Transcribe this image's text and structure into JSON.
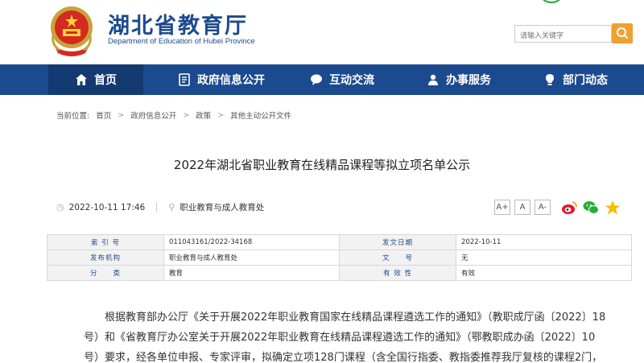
{
  "header": {
    "title": "湖北省教育厅",
    "subtitle": "Department of Education of Hubei Province",
    "search_placeholder": "请输入关键字"
  },
  "nav": {
    "items": [
      {
        "label": "首页",
        "icon": "home-icon"
      },
      {
        "label": "政府信息公开",
        "icon": "document-icon"
      },
      {
        "label": "互动交流",
        "icon": "chat-icon"
      },
      {
        "label": "办事服务",
        "icon": "service-icon"
      },
      {
        "label": "部门动态",
        "icon": "bulb-icon"
      }
    ]
  },
  "breadcrumb": {
    "label": "当前位置:",
    "items": [
      "首页",
      "政府信息公开",
      "政策",
      "其他主动公开文件"
    ],
    "separator": ">"
  },
  "article": {
    "title": "2022年湖北省职业教育在线精品课程等拟立项名单公示",
    "date": "2022-10-11 17:46",
    "department": "职业教育与成人教育处",
    "font_buttons": [
      "A+",
      "A",
      "A-"
    ]
  },
  "info_table": {
    "rows": [
      {
        "k1": "索 引 号",
        "v1": "011043161/2022-34168",
        "k2": "发文日期",
        "v2": "2022-10-11"
      },
      {
        "k1": "发布机构",
        "v1": "职业教育与成人教育处",
        "k2": "文　　号",
        "v2": "无"
      },
      {
        "k1": "分　　类",
        "v1": "教育",
        "k2": "有 效 性",
        "v2": "有效"
      }
    ]
  },
  "body": {
    "paragraph": "根据教育部办公厅《关于开展2022年职业教育国家在线精品课程遴选工作的通知》（教职成厅函〔2022〕18号）和《省教育厅办公室关于开展2022年职业教育在线精品课程遴选工作的通知》（鄂教职成办函〔2022〕10号）要求，经各单位申报、专家评审，拟确定立项128门课程（含全国行指委、教指委推荐我厅复核的课程2门，"
  },
  "colors": {
    "brand_blue": "#1c4a8e",
    "search_orange": "#f0a030"
  }
}
